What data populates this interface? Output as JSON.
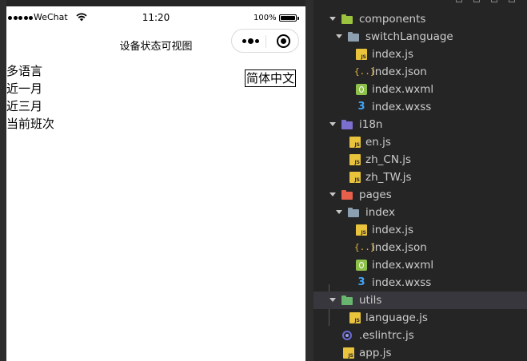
{
  "simulator": {
    "statusbar": {
      "carrier": "WeChat",
      "time": "11:20",
      "battery": "100%",
      "battery_level": 1.0
    },
    "navbar": {
      "title": "设备状态可视图"
    },
    "capsule": {
      "more_icon": "more-dots-icon",
      "close_icon": "capsule-close-icon"
    },
    "menu": [
      "多语言",
      "近一月",
      "近三月",
      "当前班次"
    ],
    "language_button": "简体中文"
  },
  "explorer": {
    "tree": [
      {
        "label": "components",
        "icon": "folder-icon",
        "color": "#9bc33e"
      },
      {
        "label": "switchLanguage",
        "icon": "folder-icon",
        "color": "#8b9fb0"
      },
      {
        "label": "index.js",
        "icon": "js-file-icon"
      },
      {
        "label": "index.json",
        "icon": "json-file-icon"
      },
      {
        "label": "index.wxml",
        "icon": "wxml-file-icon"
      },
      {
        "label": "index.wxss",
        "icon": "wxss-file-icon"
      },
      {
        "label": "i18n",
        "icon": "folder-icon",
        "color": "#7b6fd0"
      },
      {
        "label": "en.js",
        "icon": "js-file-icon"
      },
      {
        "label": "zh_CN.js",
        "icon": "js-file-icon"
      },
      {
        "label": "zh_TW.js",
        "icon": "js-file-icon"
      },
      {
        "label": "pages",
        "icon": "folder-icon",
        "color": "#e8604c"
      },
      {
        "label": "index",
        "icon": "folder-icon",
        "color": "#8b9fb0"
      },
      {
        "label": "index.js",
        "icon": "js-file-icon"
      },
      {
        "label": "index.json",
        "icon": "json-file-icon"
      },
      {
        "label": "index.wxml",
        "icon": "wxml-file-icon"
      },
      {
        "label": "index.wxss",
        "icon": "wxss-file-icon"
      },
      {
        "label": "utils",
        "icon": "folder-icon",
        "color": "#68b56d",
        "selected": true
      },
      {
        "label": "language.js",
        "icon": "js-file-icon"
      },
      {
        "label": ".eslintrc.js",
        "icon": "eslint-file-icon"
      },
      {
        "label": "app.js",
        "icon": "js-file-icon"
      }
    ]
  }
}
